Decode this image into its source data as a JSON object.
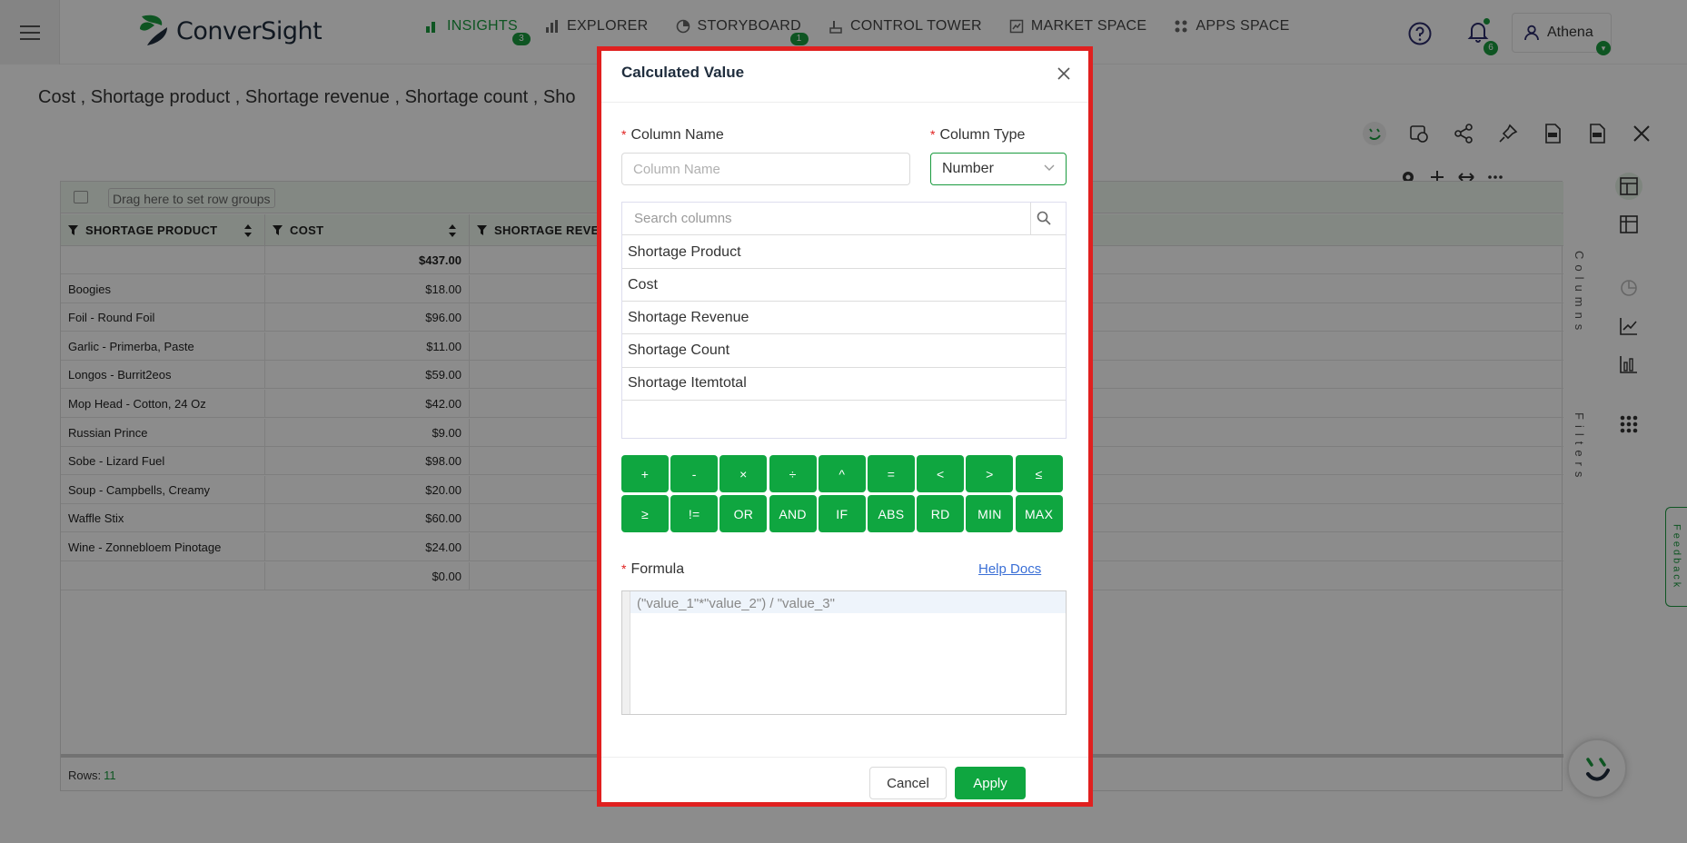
{
  "brand": {
    "name": "ConverSight",
    "color": "#1a9b3f"
  },
  "nav": {
    "items": [
      {
        "label": "INSIGHTS",
        "icon": "bar-chart-icon",
        "active": true,
        "badge": "3"
      },
      {
        "label": "EXPLORER",
        "icon": "explorer-icon",
        "active": false
      },
      {
        "label": "STORYBOARD",
        "icon": "storyboard-icon",
        "active": false,
        "badge": "1"
      },
      {
        "label": "CONTROL TOWER",
        "icon": "control-tower-icon",
        "active": false
      },
      {
        "label": "MARKET SPACE",
        "icon": "market-space-icon",
        "active": false
      },
      {
        "label": "APPS SPACE",
        "icon": "apps-space-icon",
        "active": false
      }
    ],
    "notifications_count": "6",
    "user_name": "Athena"
  },
  "page": {
    "title": "Cost , Shortage product , Shortage revenue , Shortage count , Sho"
  },
  "grid": {
    "group_placeholder": "Drag here to set row groups",
    "headers": [
      "SHORTAGE PRODUCT",
      "COST",
      "SHORTAGE REVE"
    ],
    "total": {
      "product": "",
      "cost": "$437.00"
    },
    "rows": [
      {
        "product": "Boogies",
        "cost": "$18.00"
      },
      {
        "product": "Foil - Round Foil",
        "cost": "$96.00"
      },
      {
        "product": "Garlic - Primerba, Paste",
        "cost": "$11.00"
      },
      {
        "product": "Longos - Burrit2eos",
        "cost": "$59.00"
      },
      {
        "product": "Mop Head - Cotton, 24 Oz",
        "cost": "$42.00"
      },
      {
        "product": "Russian Prince",
        "cost": "$9.00"
      },
      {
        "product": "Sobe - Lizard Fuel",
        "cost": "$98.00"
      },
      {
        "product": "Soup - Campbells, Creamy",
        "cost": "$20.00"
      },
      {
        "product": "Waffle Stix",
        "cost": "$60.00"
      },
      {
        "product": "Wine - Zonnebloem Pinotage",
        "cost": "$24.00"
      },
      {
        "product": "",
        "cost": "$0.00"
      }
    ],
    "rows_label": "Rows:",
    "rows_count": "11",
    "side_tabs": {
      "columns": "Columns",
      "filters": "Filters"
    }
  },
  "feedback_label": "Feedback",
  "modal": {
    "title": "Calculated Value",
    "column_name_label": "Column Name",
    "column_name_placeholder": "Column Name",
    "column_type_label": "Column Type",
    "column_type_value": "Number",
    "search_placeholder": "Search columns",
    "columns": [
      "Shortage Product",
      "Cost",
      "Shortage Revenue",
      "Shortage Count",
      "Shortage Itemtotal"
    ],
    "operators_row1": [
      "+",
      "-",
      "×",
      "÷",
      "^",
      "=",
      "<",
      ">",
      "≤"
    ],
    "operators_row2": [
      "≥",
      "!=",
      "OR",
      "AND",
      "IF",
      "ABS",
      "RD",
      "MIN",
      "MAX"
    ],
    "formula_label": "Formula",
    "help_docs": "Help Docs",
    "formula_placeholder": "(\"value_1\"*\"value_2\") / \"value_3\"",
    "cancel_label": "Cancel",
    "apply_label": "Apply"
  }
}
